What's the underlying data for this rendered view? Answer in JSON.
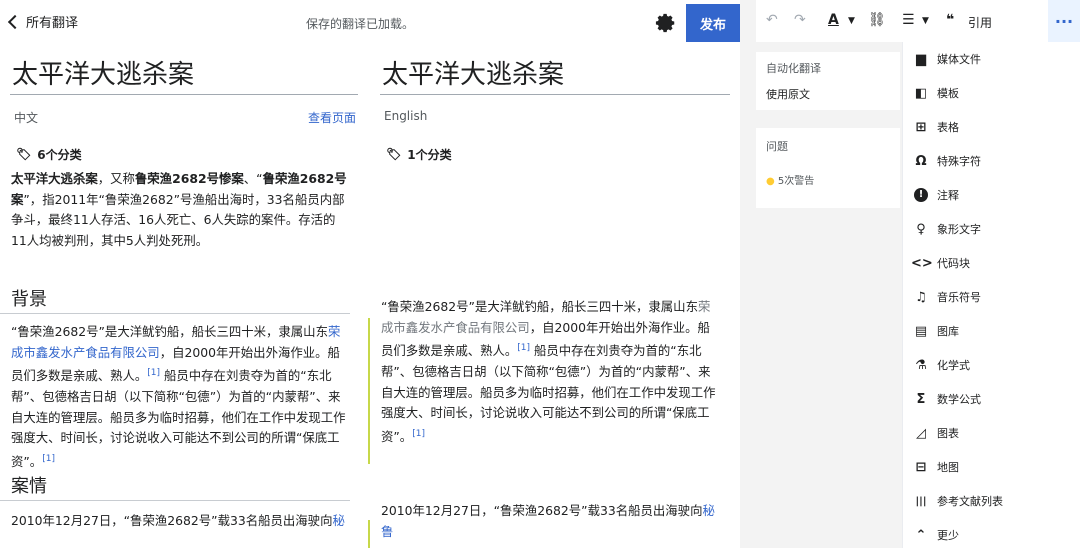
{
  "topbar": {
    "back_label": "所有翻译",
    "status": "保存的翻译已加载。",
    "publish_label": "发布"
  },
  "source": {
    "title": "太平洋大逃杀案",
    "language": "中文",
    "view_page": "查看页面",
    "categories": "6个分类",
    "intro_bold1": "太平洋大逃杀案",
    "intro_mid1": "，又称",
    "intro_bold2": "鲁荣渔2682号惨案",
    "intro_mid2": "、“",
    "intro_bold3": "鲁荣渔2682号案",
    "intro_rest": "”，指2011年“鲁荣渔2682”号渔船出海时，33名船员内部争斗，最终11人存活、16人死亡、6人失踪的案件。存活的11人均被判刑，其中5人判处死刑。",
    "h_background": "背景",
    "bg_part1": "“鲁荣渔2682号”是大洋鱿钓船，船长三四十米，隶属山东",
    "bg_link": "荣成市鑫发水产食品有限公司",
    "bg_part2": "，自2000年开始出外海作业。船员们多数是亲戚、熟人。",
    "bg_ref1": "[1]",
    "bg_part3": " 船员中存在刘贵夺为首的“东北帮”、包德格吉日胡（以下简称“包德”）为首的“内蒙帮”、来自大连的管理层。船员多为临时招募，他们在工作中发现工作强度大、时间长，讨论说收入可能达不到公司的所谓“保底工资”。",
    "bg_ref2": "[1]",
    "h_case": "案情",
    "case_part1": "2010年12月27日，“鲁荣渔2682号”载33名船员出海驶向",
    "case_link": "秘"
  },
  "target": {
    "title": "太平洋大逃杀案",
    "language": "English",
    "categories": "1个分类",
    "bg_part1": "“鲁荣渔2682号”是大洋鱿钓船，船长三四十米，隶属山东",
    "bg_link": "荣成市鑫发水产食品有限公司",
    "bg_part2": "，自2000年开始出外海作业。船员们多数是亲戚、熟人。",
    "bg_ref1": "[1]",
    "bg_part3": " 船员中存在刘贵夺为首的“东北帮”、包德格吉日胡（以下简称“包德”）为首的“内蒙帮”、来自大连的管理层。船员多为临时招募，他们在工作中发现工作强度大、时间长，讨论说收入可能达不到公司的所谓“保底工资”。",
    "bg_ref2": "[1]",
    "case_part1": "2010年12月27日，“鲁荣渔2682号”载33名船员出海驶向",
    "case_link": "秘鲁"
  },
  "toolbar": {
    "quote_label": "引用",
    "more_label": "···"
  },
  "sidebar": {
    "auto_translate": "自动化翻译",
    "use_source": "使用原文",
    "issues": "问题",
    "warnings": "5次警告"
  },
  "menu": {
    "items": [
      {
        "label": "媒体文件",
        "icon": "▆"
      },
      {
        "label": "模板",
        "icon": "◧"
      },
      {
        "label": "表格",
        "icon": "⊞"
      },
      {
        "label": "特殊字符",
        "icon": "Ω"
      },
      {
        "label": "注释",
        "icon": "!"
      },
      {
        "label": "象形文字",
        "icon": "♀"
      },
      {
        "label": "代码块",
        "icon": "<>"
      },
      {
        "label": "音乐符号",
        "icon": "♫"
      },
      {
        "label": "图库",
        "icon": "▤"
      },
      {
        "label": "化学式",
        "icon": "⚗"
      },
      {
        "label": "数学公式",
        "icon": "Σ"
      },
      {
        "label": "图表",
        "icon": "◿"
      },
      {
        "label": "地图",
        "icon": "⊟"
      },
      {
        "label": "参考文献列表",
        "icon": "|||"
      },
      {
        "label": "更少",
        "icon": "⌃"
      }
    ]
  }
}
